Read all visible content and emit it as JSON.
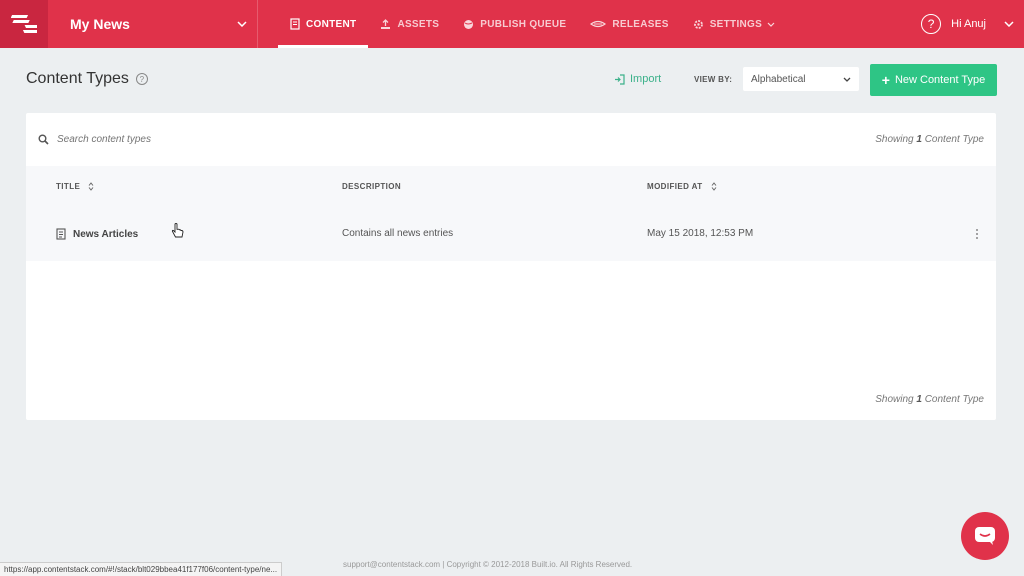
{
  "header": {
    "stack_name": "My News",
    "nav": [
      {
        "label": "CONTENT",
        "icon": "document-icon",
        "active": true
      },
      {
        "label": "ASSETS",
        "icon": "upload-icon",
        "active": false
      },
      {
        "label": "PUBLISH QUEUE",
        "icon": "globe-icon",
        "active": false
      },
      {
        "label": "RELEASES",
        "icon": "release-icon",
        "active": false
      },
      {
        "label": "SETTINGS",
        "icon": "gear-icon",
        "active": false
      }
    ],
    "help_symbol": "?",
    "user_greeting": "Hi Anuj"
  },
  "page": {
    "title": "Content Types",
    "help_symbol": "?",
    "import_label": "Import",
    "view_by_label": "VIEW BY:",
    "view_by_value": "Alphabetical",
    "new_button_label": "New Content Type",
    "new_button_symbol": "+"
  },
  "panel": {
    "search_placeholder": "Search content types",
    "showing_prefix": "Showing",
    "showing_count": "1",
    "showing_suffix": "Content Type",
    "columns": [
      "TITLE",
      "DESCRIPTION",
      "MODIFIED AT"
    ],
    "rows": [
      {
        "title": "News Articles",
        "description": "Contains all news entries",
        "modified_at": "May 15 2018, 12:53 PM"
      }
    ]
  },
  "footer": {
    "text": "support@contentstack.com | Copyright © 2012-2018 Built.io. All Rights Reserved.",
    "status_url": "https://app.contentstack.com/#!/stack/blt029bbea41f177f06/content-type/ne..."
  },
  "colors": {
    "brand": "#e0324a",
    "accent_green": "#2ec585",
    "import_green": "#3bb18a"
  }
}
